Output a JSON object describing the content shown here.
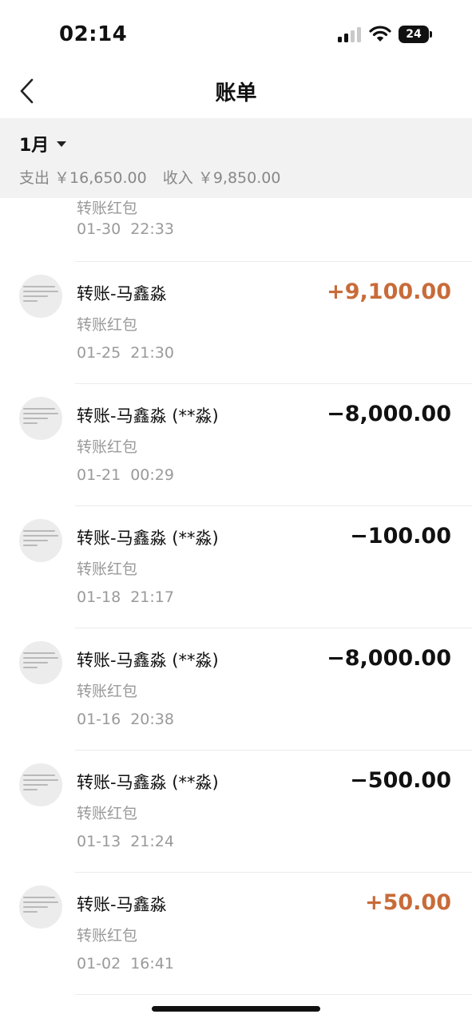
{
  "status_bar": {
    "time": "02:14",
    "battery_level": "24"
  },
  "nav": {
    "title": "账单"
  },
  "summary": {
    "month": "1月",
    "expense_text": "支出 ￥16,650.00",
    "income_text": "收入 ￥9,850.00"
  },
  "partial_top": {
    "subtitle": "转账红包",
    "date": "01-30",
    "time": "22:33"
  },
  "transactions": [
    {
      "title": "转账-马鑫淼",
      "subtitle": "转账红包",
      "date": "01-25",
      "time": "21:30",
      "amount": "+9,100.00",
      "type": "income"
    },
    {
      "title": "转账-马鑫淼 (**淼)",
      "subtitle": "转账红包",
      "date": "01-21",
      "time": "00:29",
      "amount": "−8,000.00",
      "type": "expense"
    },
    {
      "title": "转账-马鑫淼 (**淼)",
      "subtitle": "转账红包",
      "date": "01-18",
      "time": "21:17",
      "amount": "−100.00",
      "type": "expense"
    },
    {
      "title": "转账-马鑫淼 (**淼)",
      "subtitle": "转账红包",
      "date": "01-16",
      "time": "20:38",
      "amount": "−8,000.00",
      "type": "expense"
    },
    {
      "title": "转账-马鑫淼 (**淼)",
      "subtitle": "转账红包",
      "date": "01-13",
      "time": "21:24",
      "amount": "−500.00",
      "type": "expense"
    },
    {
      "title": "转账-马鑫淼",
      "subtitle": "转账红包",
      "date": "01-02",
      "time": "16:41",
      "amount": "+50.00",
      "type": "income"
    }
  ],
  "colors": {
    "income": "#c86b39",
    "expense": "#111111",
    "summary_bg": "#f2f2f2"
  }
}
